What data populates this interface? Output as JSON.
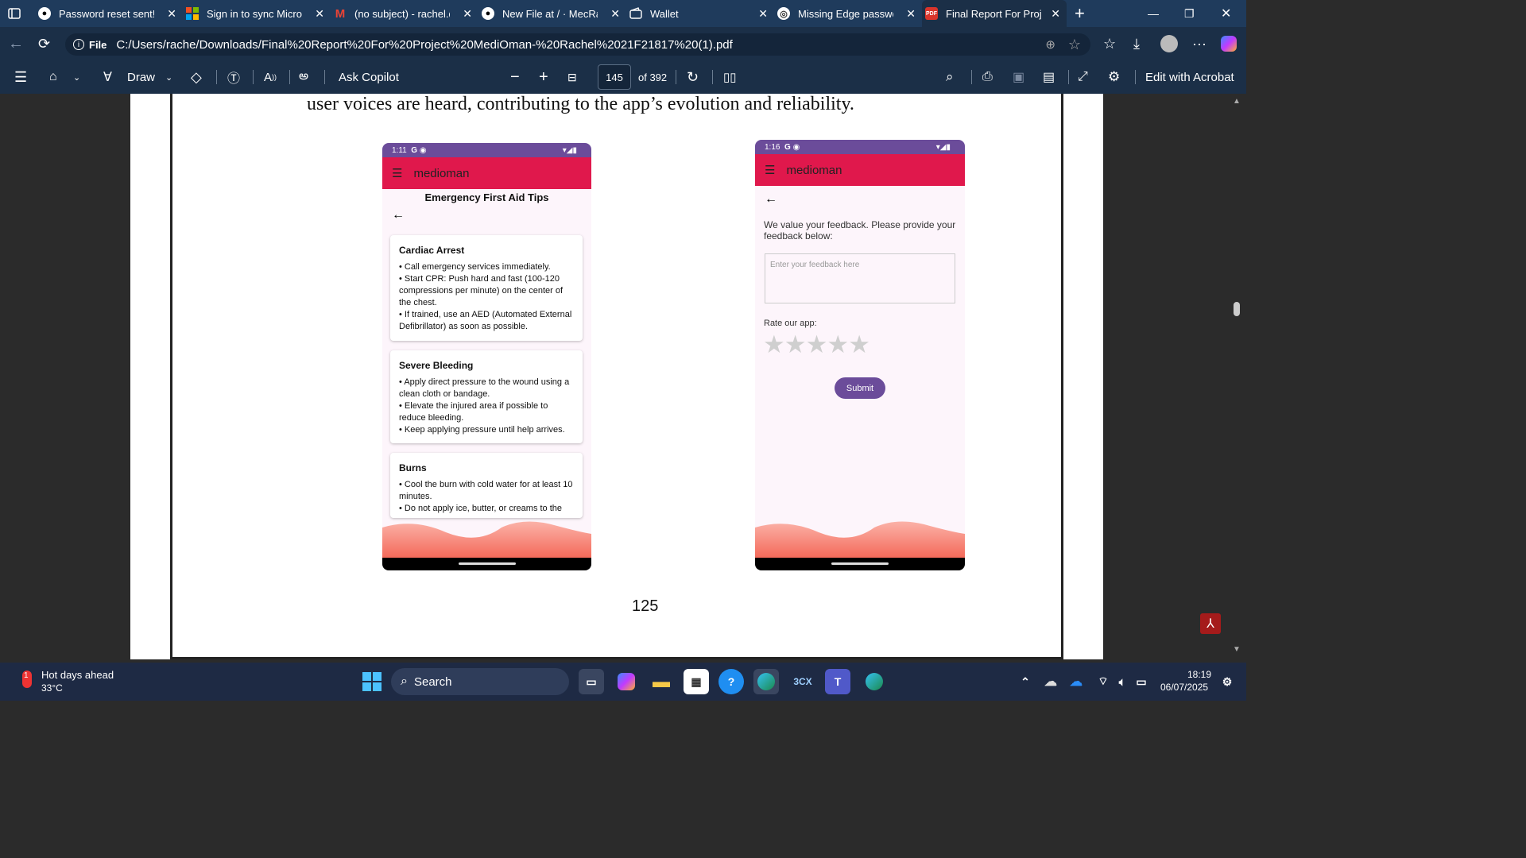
{
  "tabs": [
    {
      "title": "Password reset sent! · G",
      "icon": "github-icon"
    },
    {
      "title": "Sign in to sync Microsoft",
      "icon": "microsoft-icon"
    },
    {
      "title": "(no subject) - rachel.ds",
      "icon": "gmail-icon"
    },
    {
      "title": "New File at / · MecRach",
      "icon": "github-icon"
    },
    {
      "title": "Wallet",
      "icon": "wallet-icon"
    },
    {
      "title": "Missing Edge passwords",
      "icon": "edge-icon"
    },
    {
      "title": "Final Report For Project",
      "icon": "pdf-icon"
    }
  ],
  "address": {
    "scheme": "File",
    "url": "C:/Users/rache/Downloads/Final%20Report%20For%20Project%20MediOman-%20Rachel%2021F21817%20(1).pdf"
  },
  "pdf_toolbar": {
    "draw": "Draw",
    "ask": "Ask Copilot",
    "page_current": "145",
    "page_total": "of 392",
    "acrobat": "Edit with Acrobat"
  },
  "doc": {
    "heading_text": "user voices are heard, contributing to the app’s evolution and reliability.",
    "page_number": "125",
    "phone1": {
      "time": "1:11",
      "app": "medioman",
      "screen_title": "Emergency First Aid Tips",
      "cards": [
        {
          "title": "Cardiac Arrest",
          "items": [
            "Call emergency services immediately.",
            "Start CPR: Push hard and fast (100-120 compressions per minute) on the center of the chest.",
            "If trained, use an AED (Automated External Defibrillator) as soon as possible."
          ]
        },
        {
          "title": "Severe Bleeding",
          "items": [
            "Apply direct pressure to the wound using a clean cloth or bandage.",
            "Elevate the injured area if possible to reduce bleeding.",
            "Keep applying pressure until help arrives."
          ]
        },
        {
          "title": "Burns",
          "items": [
            "Cool the burn with cold water for at least 10 minutes.",
            "Do not apply ice, butter, or creams to the"
          ]
        }
      ]
    },
    "phone2": {
      "time": "1:16",
      "app": "medioman",
      "prompt": "We value your feedback. Please provide your feedback below:",
      "placeholder": "Enter your feedback here",
      "rate_label": "Rate our app:",
      "stars": 5,
      "submit": "Submit"
    }
  },
  "taskbar": {
    "weather_title": "Hot days ahead",
    "weather_temp": "33°C",
    "search": "Search",
    "time": "18:19",
    "date": "06/07/2025",
    "badge": "1"
  },
  "colors": {
    "appbar": "#e0184c",
    "statusbar": "#6b4c9a",
    "submit": "#6b4c9a"
  }
}
